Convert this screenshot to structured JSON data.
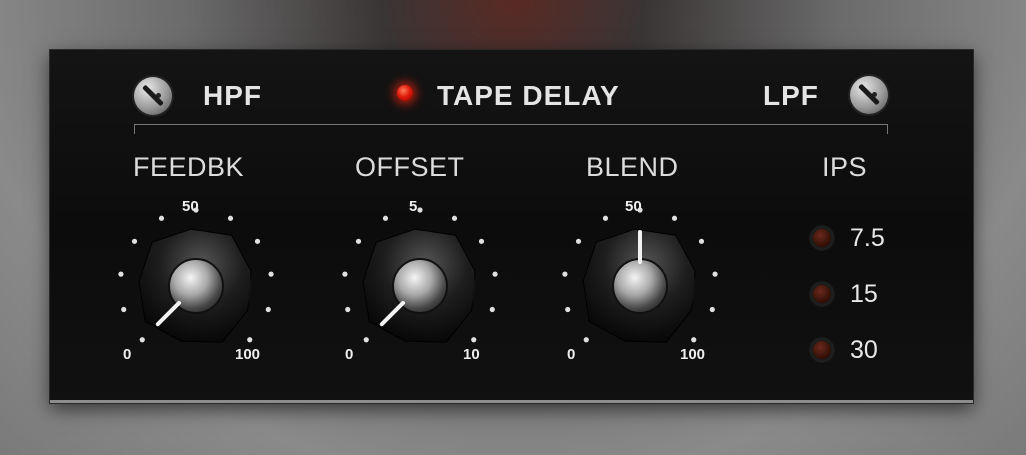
{
  "header": {
    "hpf_label": "HPF",
    "title": "TAPE DELAY",
    "lpf_label": "LPF"
  },
  "knobs": [
    {
      "name": "feedbk",
      "label": "FEEDBK",
      "min_label": "0",
      "mid_label": "50",
      "max_label": "100",
      "min": 0,
      "max": 100,
      "value": 0
    },
    {
      "name": "offset",
      "label": "OFFSET",
      "min_label": "0",
      "mid_label": "5",
      "max_label": "10",
      "min": 0,
      "max": 10,
      "value": 0
    },
    {
      "name": "blend",
      "label": "BLEND",
      "min_label": "0",
      "mid_label": "50",
      "max_label": "100",
      "min": 0,
      "max": 100,
      "value": 50
    }
  ],
  "ips": {
    "label": "IPS",
    "options": [
      "7.5",
      "15",
      "30"
    ]
  },
  "colors": {
    "led_on": "#ff2a10",
    "led_off": "#4a1a10",
    "panel": "#111111"
  }
}
